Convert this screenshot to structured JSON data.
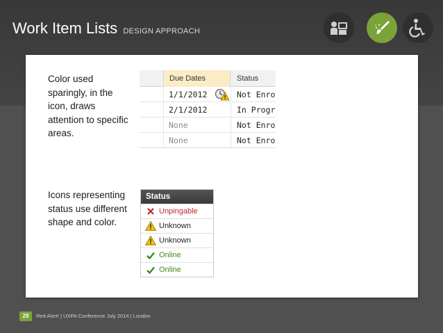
{
  "slide": {
    "title": "Work Item Lists",
    "subtitle": "DESIGN APPROACH",
    "page_number": "29",
    "footer": "Red Alert!  |  UXPA Conference July 2014  |  London"
  },
  "top_icons": [
    {
      "name": "presentation-icon",
      "style": "dark"
    },
    {
      "name": "paintbrush-icon",
      "style": "green",
      "color": "#7aa33a"
    },
    {
      "name": "accessibility-icon",
      "style": "dark"
    }
  ],
  "notes": {
    "color_note": "Color used sparingly, in the icon, draws attention to specific areas.",
    "icons_note": "Icons representing status use different shape and color."
  },
  "dates_table": {
    "headers": {
      "due": "Due Dates",
      "status": "Status"
    },
    "rows": [
      {
        "due": "1/1/2012",
        "status": "Not Enroll",
        "due_color": "#222222",
        "icon": "clock-warning-icon"
      },
      {
        "due": "2/1/2012",
        "status": "In Progres",
        "due_color": "#222222"
      },
      {
        "due": "None",
        "status": "Not Enroll",
        "due_color": "#8a8a8a"
      },
      {
        "due": "None",
        "status": "Not Enroll",
        "due_color": "#8a8a8a"
      }
    ]
  },
  "status_list": {
    "header": "Status",
    "items": [
      {
        "label": "Unpingable",
        "icon": "x-icon",
        "tone": "red"
      },
      {
        "label": "Unknown",
        "icon": "warning-icon",
        "tone": "dark"
      },
      {
        "label": "Unknown",
        "icon": "warning-icon",
        "tone": "dark"
      },
      {
        "label": "Online",
        "icon": "check-icon",
        "tone": "green"
      },
      {
        "label": "Online",
        "icon": "check-icon",
        "tone": "green"
      }
    ]
  },
  "colors": {
    "accent_green": "#7aa33a",
    "error_red": "#c0272d",
    "success_green": "#3c8a1e",
    "highlight_header": "#fbecc6"
  }
}
